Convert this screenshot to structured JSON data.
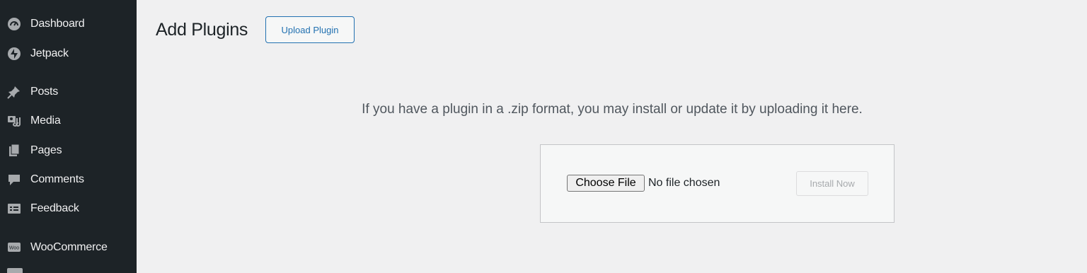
{
  "sidebar": {
    "items": [
      {
        "label": "Dashboard",
        "icon": "dashboard-icon"
      },
      {
        "label": "Jetpack",
        "icon": "jetpack-icon"
      },
      {
        "label": "Posts",
        "icon": "pin-icon"
      },
      {
        "label": "Media",
        "icon": "media-icon"
      },
      {
        "label": "Pages",
        "icon": "pages-icon"
      },
      {
        "label": "Comments",
        "icon": "comment-icon"
      },
      {
        "label": "Feedback",
        "icon": "feedback-icon"
      },
      {
        "label": "WooCommerce",
        "icon": "woocommerce-icon"
      }
    ]
  },
  "header": {
    "title": "Add Plugins",
    "upload_button": "Upload Plugin"
  },
  "upload": {
    "help_text": "If you have a plugin in a .zip format, you may install or update it by uploading it here.",
    "choose_file_label": "Choose File",
    "file_status": "No file chosen",
    "install_button": "Install Now"
  },
  "colors": {
    "sidebar_bg": "#1d2327",
    "page_bg": "#f0f0f1",
    "accent": "#2271b1"
  }
}
